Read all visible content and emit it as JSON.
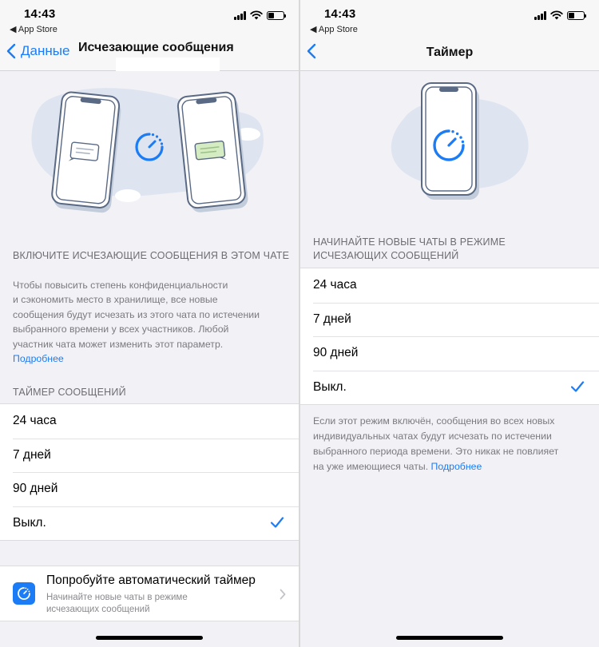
{
  "left": {
    "status": {
      "time": "14:43",
      "back_app": "◀ App Store"
    },
    "nav": {
      "back_label": "Данные",
      "title": "Исчезающие сообщения"
    },
    "section_enable": "ВКЛЮЧИТЕ ИСЧЕЗАЮЩИЕ СООБЩЕНИЯ В ЭТОМ ЧАТЕ",
    "description": [
      "Чтобы повысить степень конфиденциальности",
      "и сэкономить место в хранилище, все новые",
      "сообщения будут исчезать из этого чата по истечении",
      "выбранного времени у всех участников. Любой",
      "участник чата может изменить этот параметр."
    ],
    "learn_more": "Подробнее",
    "timer_header": "ТАЙМЕР СООБЩЕНИЙ",
    "options": [
      {
        "label": "24 часа",
        "selected": false
      },
      {
        "label": "7 дней",
        "selected": false
      },
      {
        "label": "90 дней",
        "selected": false
      },
      {
        "label": "Выкл.",
        "selected": true
      }
    ],
    "promo": {
      "title": "Попробуйте автоматический таймер",
      "subtitle": [
        "Начинайте новые чаты в режиме",
        "исчезающих сообщений"
      ]
    }
  },
  "right": {
    "status": {
      "time": "14:43",
      "back_app": "◀ App Store"
    },
    "nav": {
      "title": "Таймер"
    },
    "header": [
      "НАЧИНАЙТЕ НОВЫЕ ЧАТЫ В РЕЖИМЕ",
      "ИСЧЕЗАЮЩИХ СООБЩЕНИЙ"
    ],
    "options": [
      {
        "label": "24 часа",
        "selected": false
      },
      {
        "label": "7 дней",
        "selected": false
      },
      {
        "label": "90 дней",
        "selected": false
      },
      {
        "label": "Выкл.",
        "selected": true
      }
    ],
    "footer": [
      "Если этот режим включён, сообщения во всех новых",
      "индивидуальных чатах будут исчезать по истечении",
      "выбранного периода времени. Это никак не повлияет",
      "на уже имеющиеся чаты."
    ],
    "learn_more": "Подробнее"
  },
  "colors": {
    "accent": "#1b7cf5",
    "background": "#f2f2f6",
    "blob": "#dfe5f0",
    "bubble_green": "#d5ecc2"
  },
  "icons": [
    "chevron-left-icon",
    "cellular-signal-icon",
    "wifi-icon",
    "battery-icon",
    "timer-icon",
    "checkmark-icon",
    "chevron-right-icon"
  ]
}
